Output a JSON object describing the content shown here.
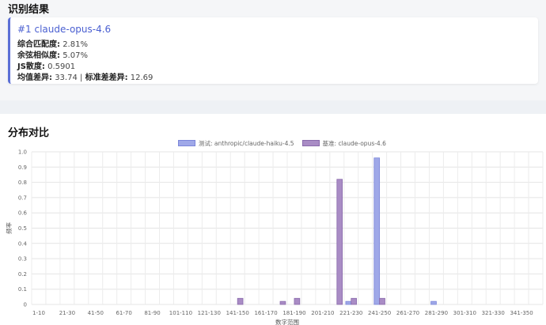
{
  "section_result": {
    "title": "识别结果"
  },
  "result": {
    "rank_title": "#1 claude-opus-4.6",
    "metrics": [
      {
        "label": "综合匹配度:",
        "value": "2.81%"
      },
      {
        "label": "余弦相似度:",
        "value": "5.07%"
      },
      {
        "label": "JS散度:",
        "value": "0.5901"
      }
    ],
    "mean_label": "均值差异:",
    "mean_value": "33.74",
    "separator": "|",
    "std_label": "标准差差异:",
    "std_value": "12.69"
  },
  "section_chart": {
    "title": "分布对比"
  },
  "chart_data": {
    "type": "bar",
    "xlabel": "数字范围",
    "ylabel": "频率",
    "ylim": [
      0,
      1.0
    ],
    "yticks": [
      "0",
      "0.1",
      "0.2",
      "0.3",
      "0.4",
      "0.5",
      "0.6",
      "0.7",
      "0.8",
      "0.9",
      "1.0"
    ],
    "grid": true,
    "legend_position": "top-center",
    "categories": [
      "1-10",
      "11-20",
      "21-30",
      "31-40",
      "41-50",
      "51-60",
      "61-70",
      "71-80",
      "81-90",
      "91-100",
      "101-110",
      "111-120",
      "121-130",
      "131-140",
      "141-150",
      "151-160",
      "161-170",
      "171-180",
      "181-190",
      "191-200",
      "201-210",
      "211-220",
      "221-230",
      "231-240",
      "241-250",
      "251-260",
      "261-270",
      "271-280",
      "281-290",
      "291-300",
      "301-310",
      "311-320",
      "321-330",
      "331-340",
      "341-350",
      "351-360"
    ],
    "series": [
      {
        "name": "测试: anthropic/claude-haiku-4.5",
        "color": "#9fa8e8",
        "border": "#7b86d9",
        "values": [
          0,
          0,
          0,
          0,
          0,
          0,
          0,
          0,
          0,
          0,
          0,
          0,
          0,
          0,
          0,
          0,
          0,
          0,
          0,
          0,
          0,
          0,
          0.02,
          0,
          0.96,
          0,
          0,
          0,
          0.02,
          0,
          0,
          0,
          0,
          0,
          0,
          0
        ]
      },
      {
        "name": "基准: claude-opus-4.6",
        "color": "#a98cc5",
        "border": "#8a6aab",
        "values": [
          0,
          0,
          0,
          0,
          0,
          0,
          0,
          0,
          0,
          0,
          0,
          0,
          0,
          0,
          0.04,
          0,
          0,
          0.02,
          0.04,
          0,
          0,
          0.82,
          0.04,
          0,
          0.04,
          0,
          0,
          0,
          0,
          0,
          0,
          0,
          0,
          0,
          0,
          0
        ]
      }
    ]
  }
}
